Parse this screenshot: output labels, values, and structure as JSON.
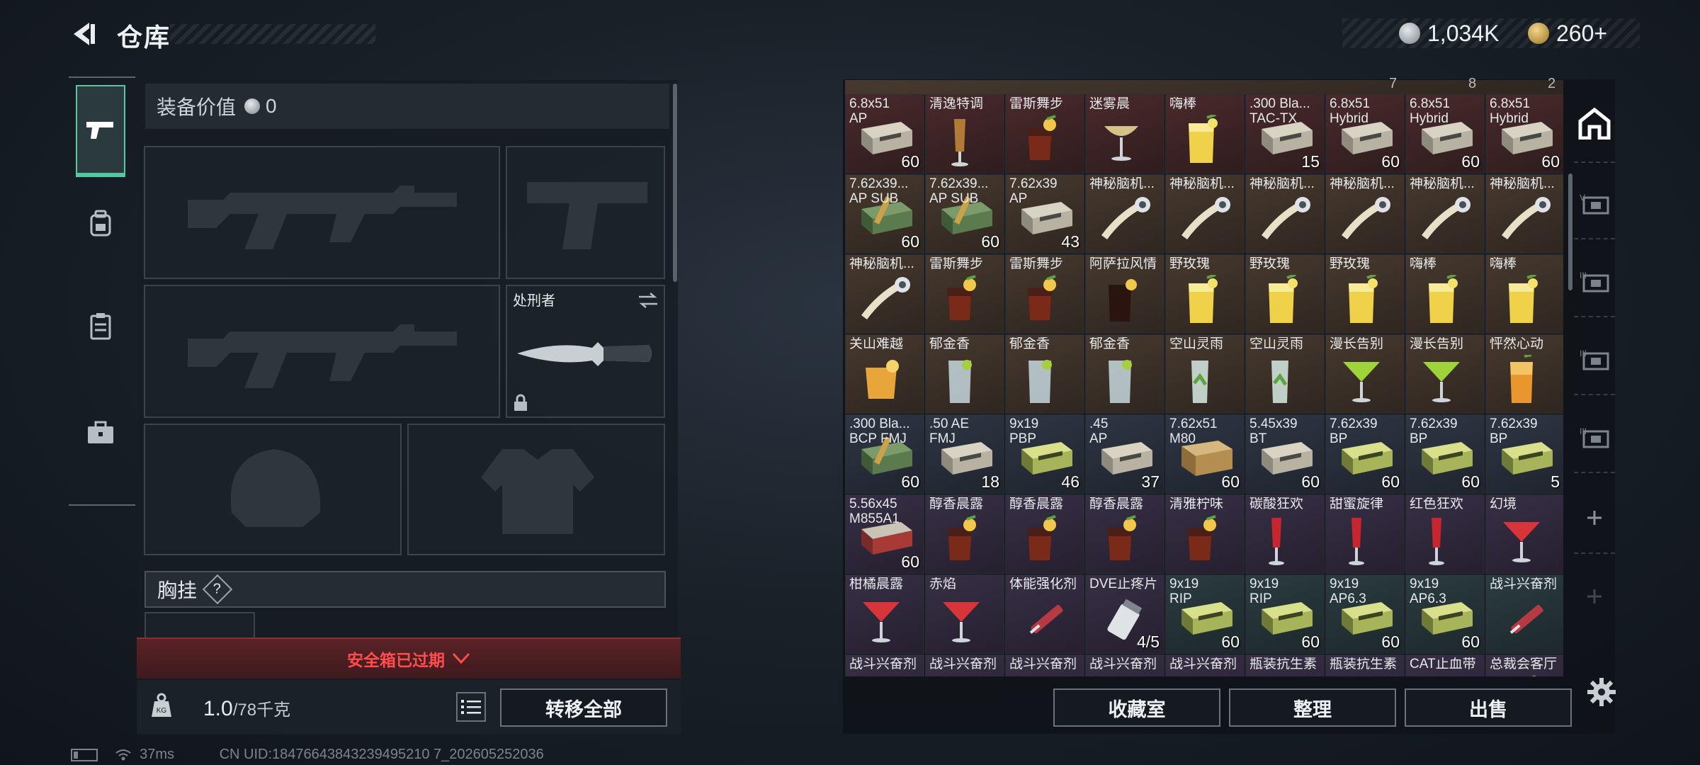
{
  "header": {
    "title": "仓库"
  },
  "currency": {
    "silver": "1,034K",
    "gold": "260+"
  },
  "equipment": {
    "value_label": "装备价值",
    "value": "0",
    "melee_name": "处刑者",
    "chest_rig_label": "胸挂",
    "chest_rig_help": "?",
    "safebox_status": "安全箱已过期",
    "weight_current": "1.0",
    "weight_max": "/78千克",
    "transfer_all_label": "转移全部"
  },
  "stash": {
    "top_partial_counts": [
      "7",
      "8",
      "2"
    ],
    "rows": [
      [
        {
          "name": "6.8x51",
          "sub": "AP",
          "qty": "60",
          "icon": "ammo-box",
          "bg": "red"
        },
        {
          "name": "清逸特调",
          "qty": "",
          "icon": "cocktail-tall",
          "bg": "red"
        },
        {
          "name": "雷斯舞步",
          "qty": "",
          "icon": "cocktail-dark",
          "bg": "red"
        },
        {
          "name": "迷雾晨",
          "qty": "",
          "icon": "cocktail-coupe",
          "bg": "red"
        },
        {
          "name": "嗨棒",
          "qty": "",
          "icon": "highball-yellow",
          "bg": "red"
        },
        {
          "name": ".300 Bla...",
          "sub": "TAC-TX",
          "qty": "15",
          "icon": "ammo-box",
          "bg": "red"
        },
        {
          "name": "6.8x51",
          "sub": "Hybrid",
          "qty": "60",
          "icon": "ammo-box",
          "bg": "red"
        },
        {
          "name": "6.8x51",
          "sub": "Hybrid",
          "qty": "60",
          "icon": "ammo-box",
          "bg": "red"
        },
        {
          "name": "6.8x51",
          "sub": "Hybrid",
          "qty": "60",
          "icon": "ammo-box",
          "bg": "red"
        }
      ],
      [
        {
          "name": "7.62x39...",
          "sub": "AP SUB",
          "qty": "60",
          "icon": "ammo-green",
          "bg": "brown"
        },
        {
          "name": "7.62x39...",
          "sub": "AP SUB",
          "qty": "60",
          "icon": "ammo-green",
          "bg": "brown"
        },
        {
          "name": "7.62x39",
          "sub": "AP",
          "qty": "43",
          "icon": "ammo-box",
          "bg": "brown"
        },
        {
          "name": "神秘脑机...",
          "qty": "",
          "icon": "neural-device",
          "bg": "brown"
        },
        {
          "name": "神秘脑机...",
          "qty": "",
          "icon": "neural-device",
          "bg": "brown"
        },
        {
          "name": "神秘脑机...",
          "qty": "",
          "icon": "neural-device",
          "bg": "brown"
        },
        {
          "name": "神秘脑机...",
          "qty": "",
          "icon": "neural-device",
          "bg": "brown"
        },
        {
          "name": "神秘脑机...",
          "qty": "",
          "icon": "neural-device",
          "bg": "brown"
        },
        {
          "name": "神秘脑机...",
          "qty": "",
          "icon": "neural-device",
          "bg": "brown"
        }
      ],
      [
        {
          "name": "神秘脑机...",
          "qty": "",
          "icon": "neural-device",
          "bg": "brown"
        },
        {
          "name": "雷斯舞步",
          "qty": "",
          "icon": "cocktail-dark",
          "bg": "brown"
        },
        {
          "name": "雷斯舞步",
          "qty": "",
          "icon": "cocktail-dark",
          "bg": "brown"
        },
        {
          "name": "阿萨拉风情",
          "qty": "",
          "icon": "cocktail-cola",
          "bg": "brown"
        },
        {
          "name": "野玫瑰",
          "qty": "",
          "icon": "highball-yellow",
          "bg": "brown"
        },
        {
          "name": "野玫瑰",
          "qty": "",
          "icon": "highball-yellow",
          "bg": "brown"
        },
        {
          "name": "野玫瑰",
          "qty": "",
          "icon": "highball-yellow",
          "bg": "brown"
        },
        {
          "name": "嗨棒",
          "qty": "",
          "icon": "highball-yellow",
          "bg": "brown"
        },
        {
          "name": "嗨棒",
          "qty": "",
          "icon": "highball-yellow",
          "bg": "brown"
        }
      ],
      [
        {
          "name": "关山难越",
          "qty": "",
          "icon": "whiskey-orange",
          "bg": "brown"
        },
        {
          "name": "郁金香",
          "qty": "",
          "icon": "glass-clear",
          "bg": "brown"
        },
        {
          "name": "郁金香",
          "qty": "",
          "icon": "glass-clear",
          "bg": "brown"
        },
        {
          "name": "郁金香",
          "qty": "",
          "icon": "glass-clear",
          "bg": "brown"
        },
        {
          "name": "空山灵雨",
          "qty": "",
          "icon": "mojito",
          "bg": "brown"
        },
        {
          "name": "空山灵雨",
          "qty": "",
          "icon": "mojito",
          "bg": "brown"
        },
        {
          "name": "漫长告别",
          "qty": "",
          "icon": "martini-green",
          "bg": "brown"
        },
        {
          "name": "漫长告别",
          "qty": "",
          "icon": "martini-green",
          "bg": "brown"
        },
        {
          "name": "怦然心动",
          "qty": "",
          "icon": "highball-orange",
          "bg": "brown"
        }
      ],
      [
        {
          "name": ".300 Bla...",
          "sub": "BCP FMJ",
          "qty": "60",
          "icon": "ammo-green",
          "bg": "blue"
        },
        {
          "name": ".50 AE",
          "sub": "FMJ",
          "qty": "18",
          "icon": "ammo-box",
          "bg": "blue"
        },
        {
          "name": "9x19",
          "sub": "PBP",
          "qty": "46",
          "icon": "ammo-lime",
          "bg": "blue"
        },
        {
          "name": ".45",
          "sub": "AP",
          "qty": "37",
          "icon": "ammo-box",
          "bg": "blue"
        },
        {
          "name": "7.62x51",
          "sub": "M80",
          "qty": "60",
          "icon": "ammo-crate",
          "bg": "blue"
        },
        {
          "name": "5.45x39",
          "sub": "BT",
          "qty": "60",
          "icon": "ammo-box",
          "bg": "blue"
        },
        {
          "name": "7.62x39",
          "sub": "BP",
          "qty": "60",
          "icon": "ammo-lime",
          "bg": "blue"
        },
        {
          "name": "7.62x39",
          "sub": "BP",
          "qty": "60",
          "icon": "ammo-lime",
          "bg": "blue"
        },
        {
          "name": "7.62x39",
          "sub": "BP",
          "qty": "5",
          "icon": "ammo-lime",
          "bg": "blue"
        }
      ],
      [
        {
          "name": "5.56x45",
          "sub": "M855A1",
          "qty": "60",
          "icon": "ammo-red",
          "bg": "purple"
        },
        {
          "name": "醇香晨露",
          "qty": "",
          "icon": "cocktail-dark",
          "bg": "purple"
        },
        {
          "name": "醇香晨露",
          "qty": "",
          "icon": "cocktail-dark",
          "bg": "purple"
        },
        {
          "name": "醇香晨露",
          "qty": "",
          "icon": "cocktail-dark",
          "bg": "purple"
        },
        {
          "name": "清雅柠味",
          "qty": "",
          "icon": "cocktail-dark",
          "bg": "purple"
        },
        {
          "name": "碳酸狂欢",
          "qty": "",
          "icon": "flute-red",
          "bg": "purple"
        },
        {
          "name": "甜蜜旋律",
          "qty": "",
          "icon": "flute-red",
          "bg": "purple"
        },
        {
          "name": "红色狂欢",
          "qty": "",
          "icon": "flute-red",
          "bg": "purple"
        },
        {
          "name": "幻境",
          "qty": "",
          "icon": "martini-red",
          "bg": "purple"
        }
      ],
      [
        {
          "name": "柑橘晨露",
          "qty": "",
          "icon": "martini-red",
          "bg": "purple"
        },
        {
          "name": "赤焰",
          "qty": "",
          "icon": "martini-red",
          "bg": "purple"
        },
        {
          "name": "体能强化剂",
          "qty": "",
          "icon": "syringe",
          "bg": "purple"
        },
        {
          "name": "DVE止疼片",
          "qty": "4/5",
          "icon": "pill-bottle",
          "bg": "purple"
        },
        {
          "name": "9x19",
          "sub": "RIP",
          "qty": "60",
          "icon": "ammo-lime",
          "bg": "teal"
        },
        {
          "name": "9x19",
          "sub": "RIP",
          "qty": "60",
          "icon": "ammo-lime",
          "bg": "teal"
        },
        {
          "name": "9x19",
          "sub": "AP6.3",
          "qty": "60",
          "icon": "ammo-lime",
          "bg": "teal"
        },
        {
          "name": "9x19",
          "sub": "AP6.3",
          "qty": "60",
          "icon": "ammo-lime",
          "bg": "teal"
        },
        {
          "name": "战斗兴奋剂",
          "qty": "",
          "icon": "syringe",
          "bg": "teal"
        }
      ],
      [
        {
          "name": "战斗兴奋剂",
          "qty": "",
          "icon": "syringe",
          "bg": "purple"
        },
        {
          "name": "战斗兴奋剂",
          "qty": "",
          "icon": "syringe",
          "bg": "purple"
        },
        {
          "name": "战斗兴奋剂",
          "qty": "",
          "icon": "syringe",
          "bg": "purple"
        },
        {
          "name": "战斗兴奋剂",
          "qty": "",
          "icon": "syringe",
          "bg": "purple"
        },
        {
          "name": "战斗兴奋剂",
          "qty": "",
          "icon": "syringe",
          "bg": "purple"
        },
        {
          "name": "瓶装抗生素",
          "qty": "",
          "icon": "pill-bottle",
          "bg": "purple"
        },
        {
          "name": "瓶装抗生素",
          "qty": "",
          "icon": "pill-bottle",
          "bg": "purple"
        },
        {
          "name": "CAT止血带",
          "qty": "",
          "icon": "syringe",
          "bg": "purple"
        },
        {
          "name": "总裁会客厅",
          "qty": "",
          "icon": "cocktail-dark",
          "bg": "purple"
        }
      ]
    ]
  },
  "footer_buttons": {
    "collection": "收藏室",
    "sort": "整理",
    "sell": "出售"
  },
  "status": {
    "ping": "37ms",
    "uid": "CN UID:18476643843239495210 7_202605252036"
  },
  "colors": {
    "accent": "#55c7a2",
    "alert": "#ff4d4d",
    "panel": "#1b2128"
  }
}
